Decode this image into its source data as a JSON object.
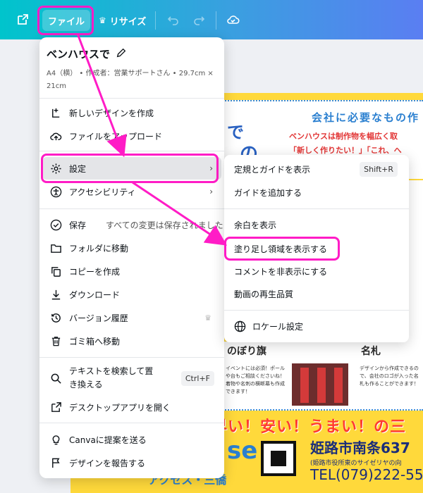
{
  "topbar": {
    "file_label": "ファイル",
    "resize_label": "リサイズ",
    "crown_glyph": "♛"
  },
  "menu": {
    "title": "ベンハウスで",
    "meta": "A4（横） • 作成者：営業サポートさん • 29.7cm × 21cm",
    "items": [
      {
        "label": "新しいデザインを作成",
        "icon": "add-page-icon"
      },
      {
        "label": "ファイルをアップロード",
        "icon": "upload-cloud-icon"
      },
      {
        "label": "設定",
        "icon": "gear-icon",
        "chevron": "›"
      },
      {
        "label": "アクセシビリティ",
        "icon": "accessibility-icon",
        "chevron": "›"
      },
      {
        "label": "保存",
        "icon": "save-check-icon",
        "note": "すべての変更は保存されました"
      },
      {
        "label": "フォルダに移動",
        "icon": "folder-icon"
      },
      {
        "label": "コピーを作成",
        "icon": "copy-icon"
      },
      {
        "label": "ダウンロード",
        "icon": "download-icon"
      },
      {
        "label": "バージョン履歴",
        "icon": "history-icon",
        "crown": "♛"
      },
      {
        "label": "ゴミ箱へ移動",
        "icon": "trash-icon"
      },
      {
        "label": "テキストを検索して置き換える",
        "label_line1": "テキストを検索して置",
        "label_line2": "き換える",
        "icon": "search-icon",
        "shortcut": "Ctrl+F"
      },
      {
        "label": "デスクトップアプリを開く",
        "icon": "external-link-icon"
      },
      {
        "label": "Canvaに提案を送る",
        "icon": "lightbulb-icon"
      },
      {
        "label": "デザインを報告する",
        "icon": "flag-icon"
      }
    ]
  },
  "submenu": {
    "items": [
      {
        "label": "定規とガイドを表示",
        "shortcut": "Shift+R"
      },
      {
        "label": "ガイドを追加する"
      },
      {
        "label": "余白を表示"
      },
      {
        "label": "塗り足し領域を表示する"
      },
      {
        "label": "コメントを非表示にする"
      },
      {
        "label": "動画の再生品質"
      },
      {
        "label": "ロケール設定",
        "icon": "globe-icon"
      }
    ]
  },
  "poster": {
    "title": "会社に必要なもの作",
    "line1": "ベンハウスは制作物を幅広く取",
    "line2": "「新しく作りたい！」「これ、へ",
    "de": "で",
    "no": "の",
    "nobori_title": "のぼり旗",
    "meifuda_title": "名札",
    "nobori_text": "イベントには必須！ポールや台もご相談くださいね！着物や名刺の横断幕も作成できます！",
    "meifuda_text": "デザインから作成できるので、会社のロゴが入った名札も作ることができます！",
    "slogan": "早い！安い！うまい！の三",
    "logo_fragment": "se",
    "address": "姫路市南条637",
    "address_sub": "(姫路市役所東のサイゼリヤの向",
    "tel": "TEL(079)222-55",
    "footer_fragment": "アクセス・三僑"
  },
  "colors": {
    "accent_teal": "#00c4cc",
    "accent_purple": "#5a7ef2",
    "highlight_magenta": "#ff1cc6",
    "poster_yellow": "#ffd93b"
  }
}
